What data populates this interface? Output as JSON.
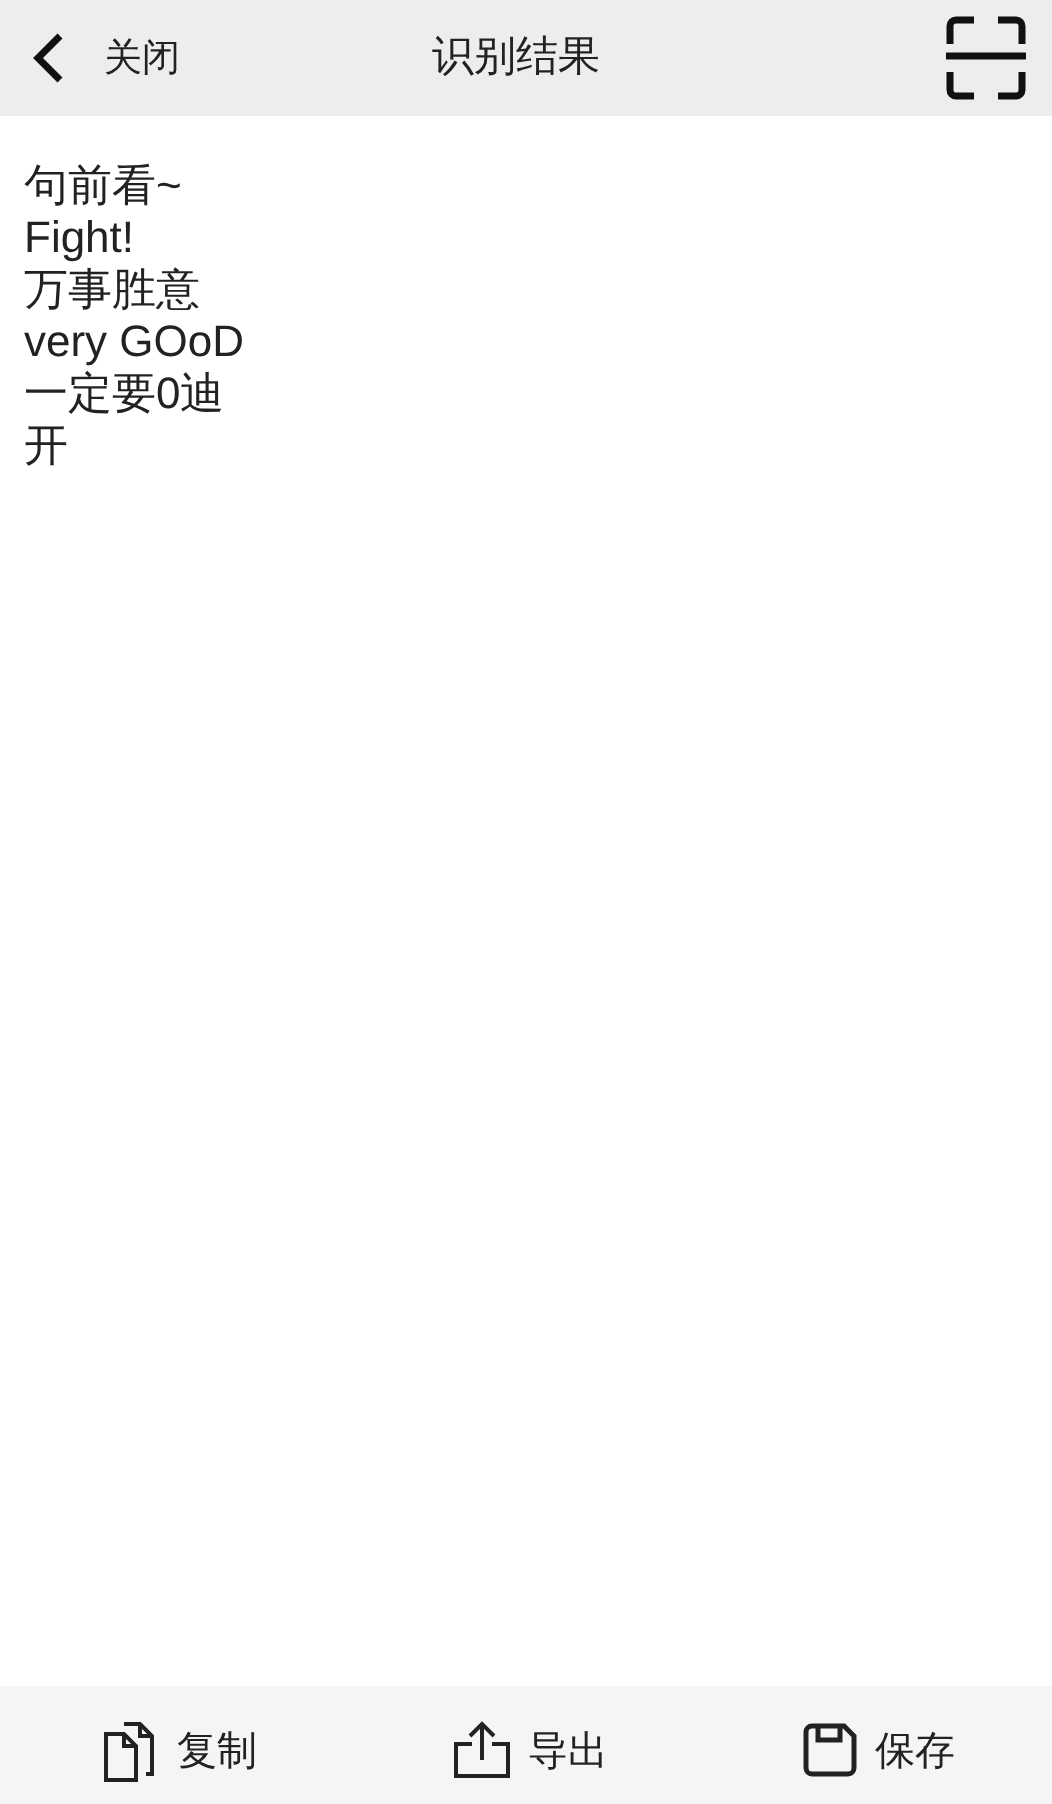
{
  "header": {
    "back_label": "关闭",
    "title": "识别结果"
  },
  "result_lines": [
    "句前看~",
    "Fight!",
    "万事胜意",
    "very GOoD",
    "一定要0迪",
    "开"
  ],
  "toolbar": [
    {
      "kind": "copy",
      "label": "复制"
    },
    {
      "kind": "export",
      "label": "导出"
    },
    {
      "kind": "save",
      "label": "保存"
    }
  ]
}
